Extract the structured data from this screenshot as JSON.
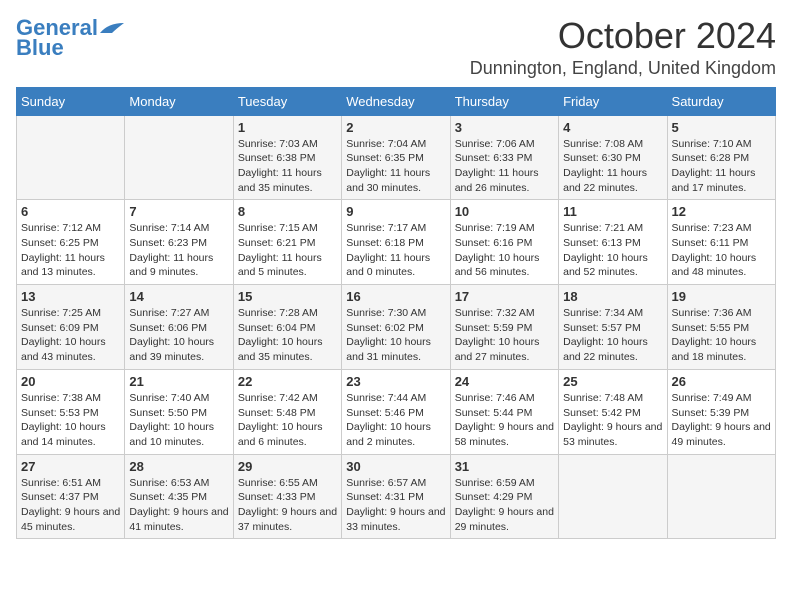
{
  "header": {
    "logo_line1": "General",
    "logo_line2": "Blue",
    "month_title": "October 2024",
    "location": "Dunnington, England, United Kingdom"
  },
  "days_of_week": [
    "Sunday",
    "Monday",
    "Tuesday",
    "Wednesday",
    "Thursday",
    "Friday",
    "Saturday"
  ],
  "weeks": [
    [
      {
        "day": "",
        "detail": ""
      },
      {
        "day": "",
        "detail": ""
      },
      {
        "day": "1",
        "detail": "Sunrise: 7:03 AM\nSunset: 6:38 PM\nDaylight: 11 hours and 35 minutes."
      },
      {
        "day": "2",
        "detail": "Sunrise: 7:04 AM\nSunset: 6:35 PM\nDaylight: 11 hours and 30 minutes."
      },
      {
        "day": "3",
        "detail": "Sunrise: 7:06 AM\nSunset: 6:33 PM\nDaylight: 11 hours and 26 minutes."
      },
      {
        "day": "4",
        "detail": "Sunrise: 7:08 AM\nSunset: 6:30 PM\nDaylight: 11 hours and 22 minutes."
      },
      {
        "day": "5",
        "detail": "Sunrise: 7:10 AM\nSunset: 6:28 PM\nDaylight: 11 hours and 17 minutes."
      }
    ],
    [
      {
        "day": "6",
        "detail": "Sunrise: 7:12 AM\nSunset: 6:25 PM\nDaylight: 11 hours and 13 minutes."
      },
      {
        "day": "7",
        "detail": "Sunrise: 7:14 AM\nSunset: 6:23 PM\nDaylight: 11 hours and 9 minutes."
      },
      {
        "day": "8",
        "detail": "Sunrise: 7:15 AM\nSunset: 6:21 PM\nDaylight: 11 hours and 5 minutes."
      },
      {
        "day": "9",
        "detail": "Sunrise: 7:17 AM\nSunset: 6:18 PM\nDaylight: 11 hours and 0 minutes."
      },
      {
        "day": "10",
        "detail": "Sunrise: 7:19 AM\nSunset: 6:16 PM\nDaylight: 10 hours and 56 minutes."
      },
      {
        "day": "11",
        "detail": "Sunrise: 7:21 AM\nSunset: 6:13 PM\nDaylight: 10 hours and 52 minutes."
      },
      {
        "day": "12",
        "detail": "Sunrise: 7:23 AM\nSunset: 6:11 PM\nDaylight: 10 hours and 48 minutes."
      }
    ],
    [
      {
        "day": "13",
        "detail": "Sunrise: 7:25 AM\nSunset: 6:09 PM\nDaylight: 10 hours and 43 minutes."
      },
      {
        "day": "14",
        "detail": "Sunrise: 7:27 AM\nSunset: 6:06 PM\nDaylight: 10 hours and 39 minutes."
      },
      {
        "day": "15",
        "detail": "Sunrise: 7:28 AM\nSunset: 6:04 PM\nDaylight: 10 hours and 35 minutes."
      },
      {
        "day": "16",
        "detail": "Sunrise: 7:30 AM\nSunset: 6:02 PM\nDaylight: 10 hours and 31 minutes."
      },
      {
        "day": "17",
        "detail": "Sunrise: 7:32 AM\nSunset: 5:59 PM\nDaylight: 10 hours and 27 minutes."
      },
      {
        "day": "18",
        "detail": "Sunrise: 7:34 AM\nSunset: 5:57 PM\nDaylight: 10 hours and 22 minutes."
      },
      {
        "day": "19",
        "detail": "Sunrise: 7:36 AM\nSunset: 5:55 PM\nDaylight: 10 hours and 18 minutes."
      }
    ],
    [
      {
        "day": "20",
        "detail": "Sunrise: 7:38 AM\nSunset: 5:53 PM\nDaylight: 10 hours and 14 minutes."
      },
      {
        "day": "21",
        "detail": "Sunrise: 7:40 AM\nSunset: 5:50 PM\nDaylight: 10 hours and 10 minutes."
      },
      {
        "day": "22",
        "detail": "Sunrise: 7:42 AM\nSunset: 5:48 PM\nDaylight: 10 hours and 6 minutes."
      },
      {
        "day": "23",
        "detail": "Sunrise: 7:44 AM\nSunset: 5:46 PM\nDaylight: 10 hours and 2 minutes."
      },
      {
        "day": "24",
        "detail": "Sunrise: 7:46 AM\nSunset: 5:44 PM\nDaylight: 9 hours and 58 minutes."
      },
      {
        "day": "25",
        "detail": "Sunrise: 7:48 AM\nSunset: 5:42 PM\nDaylight: 9 hours and 53 minutes."
      },
      {
        "day": "26",
        "detail": "Sunrise: 7:49 AM\nSunset: 5:39 PM\nDaylight: 9 hours and 49 minutes."
      }
    ],
    [
      {
        "day": "27",
        "detail": "Sunrise: 6:51 AM\nSunset: 4:37 PM\nDaylight: 9 hours and 45 minutes."
      },
      {
        "day": "28",
        "detail": "Sunrise: 6:53 AM\nSunset: 4:35 PM\nDaylight: 9 hours and 41 minutes."
      },
      {
        "day": "29",
        "detail": "Sunrise: 6:55 AM\nSunset: 4:33 PM\nDaylight: 9 hours and 37 minutes."
      },
      {
        "day": "30",
        "detail": "Sunrise: 6:57 AM\nSunset: 4:31 PM\nDaylight: 9 hours and 33 minutes."
      },
      {
        "day": "31",
        "detail": "Sunrise: 6:59 AM\nSunset: 4:29 PM\nDaylight: 9 hours and 29 minutes."
      },
      {
        "day": "",
        "detail": ""
      },
      {
        "day": "",
        "detail": ""
      }
    ]
  ]
}
